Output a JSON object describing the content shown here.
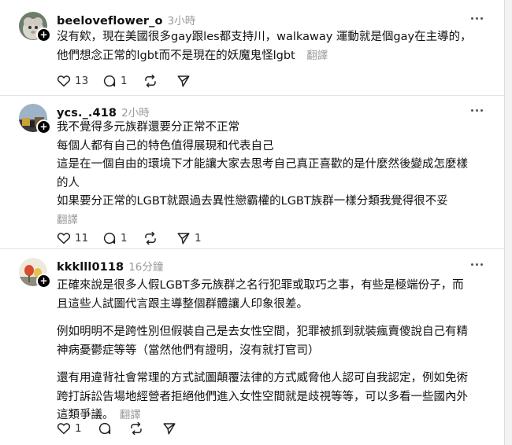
{
  "ui": {
    "translate_label": "翻譯"
  },
  "posts": [
    {
      "username": "beeloveflower_o",
      "time": "3小時",
      "lines": [
        "沒有欸，現在美國很多gay跟les都支持川，walkaway 運動就是個gay在主導的，",
        "他們想念正常的lgbt而不是現在的妖魔鬼怪lgbt"
      ],
      "likes": "13",
      "replies": "1",
      "reposts": "",
      "shares": ""
    },
    {
      "username": "ycs._.418",
      "time": "2小時",
      "lines": [
        "我不覺得多元族群還要分正常不正常",
        "每個人都有自己的特色值得展現和代表自己",
        "這是在一個自由的環境下才能讓大家去思考自己真正喜歡的是什麼然後變成怎麼樣",
        "的人",
        "如果要分正常的LGBT就跟過去異性戀霸權的LGBT族群一樣分類我覺得很不妥"
      ],
      "likes": "11",
      "replies": "1",
      "reposts": "",
      "shares": "1"
    },
    {
      "username": "kkklll0118",
      "time": "16分鐘",
      "paragraphs": [
        [
          "正確來說是很多人假LGBT多元族群之名行犯罪或取巧之事，有些是極端份子，而",
          "且這些人試圖代言跟主導整個群體讓人印象很差。"
        ],
        [
          "例如明明不是跨性別但假裝自己是去女性空間，犯罪被抓到就裝瘋賣傻說自己有精",
          "神病憂鬱症等等（當然他們有證明，沒有就打官司）"
        ],
        [
          "還有用違背社會常理的方式試圖顛覆法律的方式威脅他人認可自我認定，例如免術",
          "跨打訴訟告場地經營者拒絕他們進入女性空間就是歧視等等，可以多看一些國內外",
          "這類爭議。"
        ]
      ],
      "likes": "1",
      "replies": "",
      "reposts": "",
      "shares": ""
    }
  ]
}
